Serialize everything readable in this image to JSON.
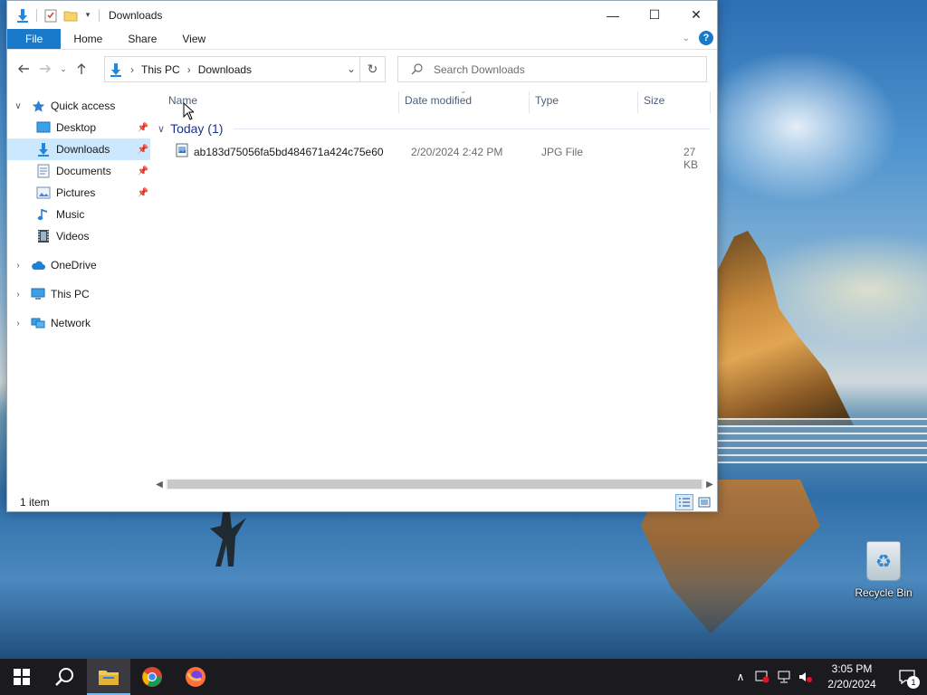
{
  "window": {
    "title": "Downloads",
    "controls": {
      "minimize": "—",
      "maximize": "☐",
      "close": "✕"
    }
  },
  "ribbon": {
    "tabs": [
      "File",
      "Home",
      "Share",
      "View"
    ],
    "help": "?"
  },
  "address": {
    "crumbs": [
      "This PC",
      "Downloads"
    ],
    "separator": "›"
  },
  "search": {
    "placeholder": "Search Downloads"
  },
  "nav": {
    "quick_access": "Quick access",
    "items": [
      {
        "label": "Desktop",
        "pinned": true
      },
      {
        "label": "Downloads",
        "pinned": true,
        "selected": true
      },
      {
        "label": "Documents",
        "pinned": true
      },
      {
        "label": "Pictures",
        "pinned": true
      },
      {
        "label": "Music",
        "pinned": false
      },
      {
        "label": "Videos",
        "pinned": false
      }
    ],
    "onedrive": "OneDrive",
    "this_pc": "This PC",
    "network": "Network"
  },
  "columns": {
    "name": "Name",
    "date": "Date modified",
    "type": "Type",
    "size": "Size"
  },
  "group": {
    "label": "Today (1)"
  },
  "files": [
    {
      "name": "ab183d75056fa5bd484671a424c75e60",
      "date": "2/20/2024 2:42 PM",
      "type": "JPG File",
      "size": "27 KB"
    }
  ],
  "status": {
    "count": "1 item"
  },
  "desktop": {
    "recycle_bin": "Recycle Bin"
  },
  "taskbar": {
    "time": "3:05 PM",
    "date": "2/20/2024",
    "notifications": "1"
  },
  "colors": {
    "accent": "#1979ca",
    "selection": "#cce8ff",
    "group_text": "#1e3287",
    "taskbar": "#1b1b1f"
  }
}
